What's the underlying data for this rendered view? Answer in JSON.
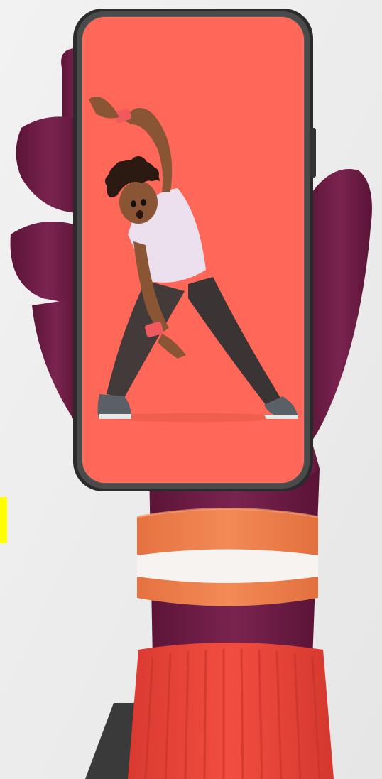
{
  "colors": {
    "background": "#eeeeee",
    "hand": "#6e1d45",
    "hand_shadow": "#4f1130",
    "screen": "#ff6759",
    "phone_frame": "#2f2f2f",
    "wristband_orange": "#f0824d",
    "wristband_white": "#f7f4f2",
    "sleeve_red": "#f0493c",
    "marker_yellow": "#ffff00",
    "figure_shirt": "#ece0ee",
    "figure_pants": "#3b3434",
    "figure_skin": "#8a5534",
    "figure_hair": "#2a1a12",
    "figure_wristband": "#ef5a5f"
  },
  "scene": {
    "subject": "hand-holding-phone",
    "screen_content": "dancing-character"
  }
}
